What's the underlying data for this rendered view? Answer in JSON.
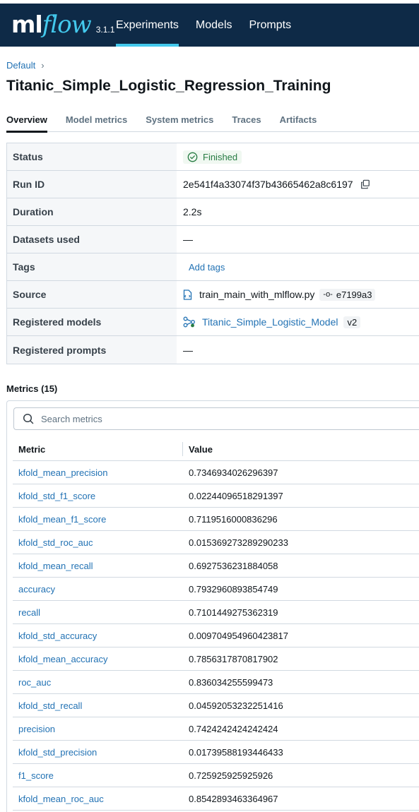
{
  "app": {
    "logo_ml": "ml",
    "logo_flow": "flow",
    "version": "3.1.1",
    "nav": [
      {
        "label": "Experiments",
        "active": true
      },
      {
        "label": "Models",
        "active": false
      },
      {
        "label": "Prompts",
        "active": false
      }
    ]
  },
  "breadcrumb": {
    "experiment": "Default",
    "separator": "›"
  },
  "run": {
    "title": "Titanic_Simple_Logistic_Regression_Training"
  },
  "tabs": [
    "Overview",
    "Model metrics",
    "System metrics",
    "Traces",
    "Artifacts"
  ],
  "overview": {
    "status_label": "Status",
    "status_value": "Finished",
    "run_id_label": "Run ID",
    "run_id_value": "2e541f4a33074f37b43665462a8c6197",
    "duration_label": "Duration",
    "duration_value": "2.2s",
    "datasets_label": "Datasets used",
    "datasets_value": "—",
    "tags_label": "Tags",
    "tags_value": "Add tags",
    "source_label": "Source",
    "source_file": "train_main_with_mlflow.py",
    "source_commit": "e7199a3",
    "models_label": "Registered models",
    "model_name": "Titanic_Simple_Logistic_Model",
    "model_version": "v2",
    "prompts_label": "Registered prompts",
    "prompts_value": "—"
  },
  "metrics": {
    "title": "Metrics (15)",
    "search_placeholder": "Search metrics",
    "col_metric": "Metric",
    "col_value": "Value",
    "rows": [
      {
        "name": "kfold_mean_precision",
        "value": "0.7346934026296397"
      },
      {
        "name": "kfold_std_f1_score",
        "value": "0.02244096518291397"
      },
      {
        "name": "kfold_mean_f1_score",
        "value": "0.7119516000836296"
      },
      {
        "name": "kfold_std_roc_auc",
        "value": "0.015369273289290233"
      },
      {
        "name": "kfold_mean_recall",
        "value": "0.6927536231884058"
      },
      {
        "name": "accuracy",
        "value": "0.7932960893854749"
      },
      {
        "name": "recall",
        "value": "0.7101449275362319"
      },
      {
        "name": "kfold_std_accuracy",
        "value": "0.009704954960423817"
      },
      {
        "name": "kfold_mean_accuracy",
        "value": "0.7856317870817902"
      },
      {
        "name": "roc_auc",
        "value": "0.836034255599473"
      },
      {
        "name": "kfold_std_recall",
        "value": "0.04592053232251416"
      },
      {
        "name": "precision",
        "value": "0.7424242424242424"
      },
      {
        "name": "kfold_std_precision",
        "value": "0.01739588193446433"
      },
      {
        "name": "f1_score",
        "value": "0.725925925925926"
      },
      {
        "name": "kfold_mean_roc_auc",
        "value": "0.8542893463364967"
      }
    ]
  },
  "colors": {
    "nav_bg": "#0e2a47",
    "accent": "#43c9ed",
    "link": "#2272b4",
    "success": "#277c43"
  }
}
